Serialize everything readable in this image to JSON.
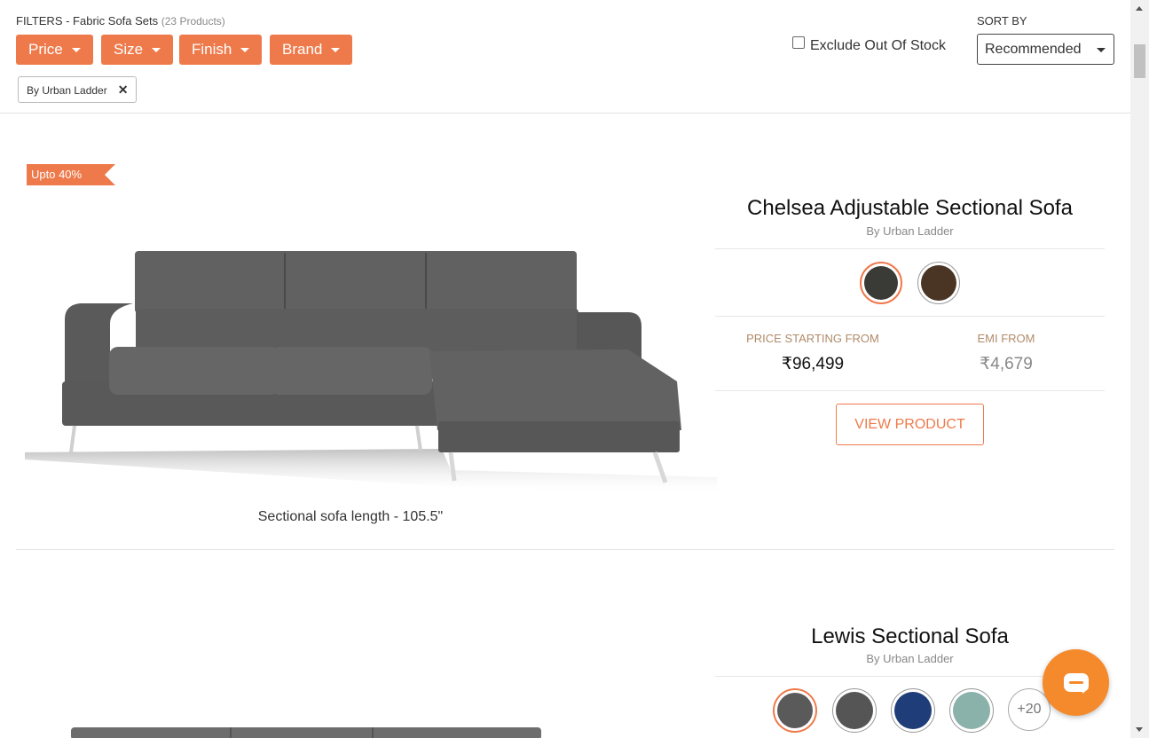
{
  "filters": {
    "title": "FILTERS - Fabric Sofa Sets",
    "count": "(23 Products)",
    "buttons": [
      {
        "label": "Price"
      },
      {
        "label": "Size"
      },
      {
        "label": "Finish"
      },
      {
        "label": "Brand"
      }
    ],
    "active_chip": "By Urban Ladder",
    "exclude_out_of_stock": "Exclude Out Of Stock",
    "sort_by_label": "SORT BY",
    "sort_value": "Recommended"
  },
  "products": [
    {
      "badge": "Upto 40%",
      "name": "Chelsea Adjustable Sectional Sofa",
      "brand": "By Urban Ladder",
      "price_label": "PRICE STARTING FROM",
      "price": "₹96,499",
      "emi_label": "EMI FROM",
      "emi": "₹4,679",
      "cta": "VIEW PRODUCT",
      "image_caption": "Sectional sofa length - 105.5\"",
      "swatches": [
        "#3a3a36",
        "#4a3525"
      ],
      "upholstery_color": "#5a5a5a"
    },
    {
      "name": "Lewis Sectional Sofa",
      "brand": "By Urban Ladder",
      "swatches": [
        "#5a5a5a",
        "#555555",
        "#1f3d78",
        "#8ab2aa"
      ],
      "more_swatches": "+20"
    }
  ],
  "colors": {
    "accent": "#ee7a4b",
    "chat": "#f58a2c"
  }
}
